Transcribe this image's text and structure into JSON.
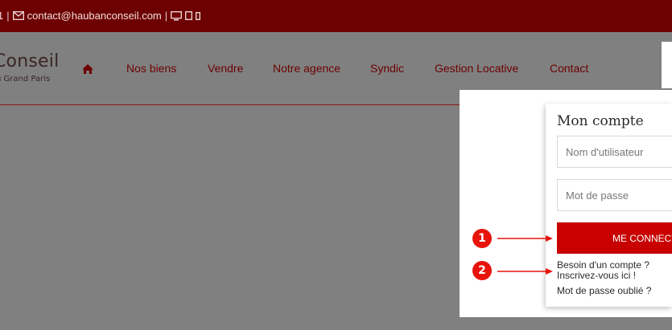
{
  "topbar": {
    "phone_tail": "1",
    "separator": "|",
    "email": "contact@haubanconseil.com",
    "icons": [
      "envelope-icon",
      "desktop-icon",
      "tablet-icon",
      "mobile-icon"
    ]
  },
  "logo": {
    "name": "Conseil",
    "tagline": "u Grand Paris"
  },
  "nav": {
    "home_icon": "home-icon",
    "items": [
      "Nos biens",
      "Vendre",
      "Notre agence",
      "Syndic",
      "Gestion Locative",
      "Contact"
    ]
  },
  "login": {
    "title": "Mon compte",
    "username_placeholder": "Nom d'utilisateur",
    "password_placeholder": "Mot de passe",
    "submit_label": "ME CONNECT",
    "register_line1": "Besoin d'un compte ?",
    "register_line2": "Inscrivez-vous ici !",
    "forgot_label": "Mot de passe oublié ?"
  },
  "annotations": {
    "marker1": "1",
    "marker2": "2"
  },
  "colors": {
    "topbar": "#6d0000",
    "accent": "#c80000",
    "marker": "#e8140c",
    "overlay": "#808080"
  }
}
